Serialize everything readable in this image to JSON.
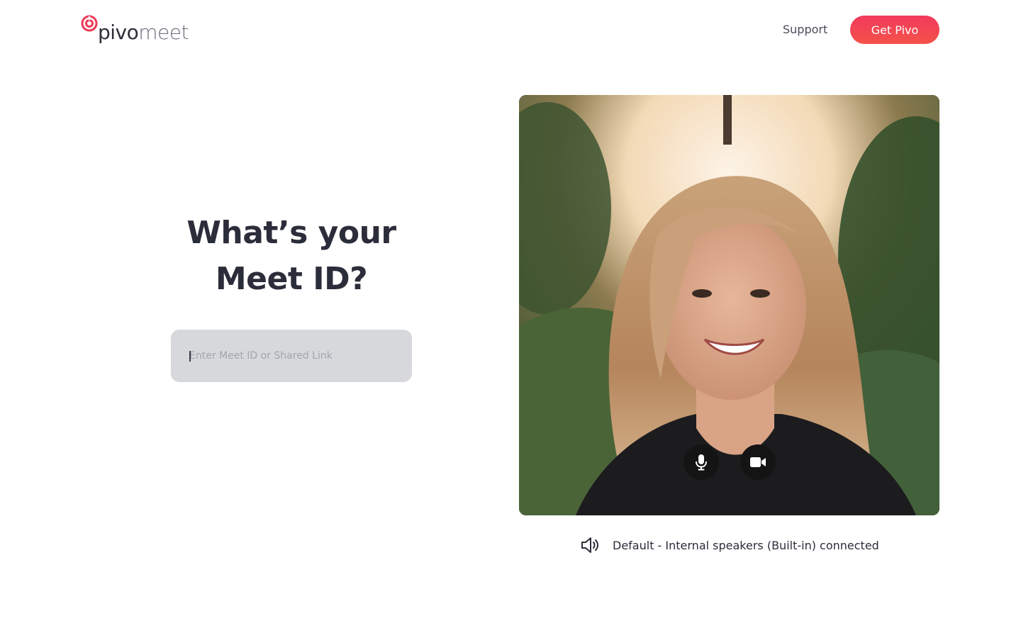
{
  "header": {
    "logo_pivo": "pivo",
    "logo_meet": "meet",
    "support_label": "Support",
    "cta_label": "Get Pivo"
  },
  "main": {
    "headline_line1": "What’s your",
    "headline_line2": "Meet ID?",
    "meet_input": {
      "placeholder": "Enter Meet ID or Shared Link",
      "value": ""
    }
  },
  "preview": {
    "mic_button_icon": "microphone-icon",
    "camera_button_icon": "video-camera-icon"
  },
  "audio_status": {
    "icon": "speaker-icon",
    "text": "Default - Internal speakers (Built-in) connected"
  },
  "colors": {
    "brand": "#f13a5c",
    "text_dark": "#2b2d3a",
    "input_bg": "#d7d8db"
  }
}
